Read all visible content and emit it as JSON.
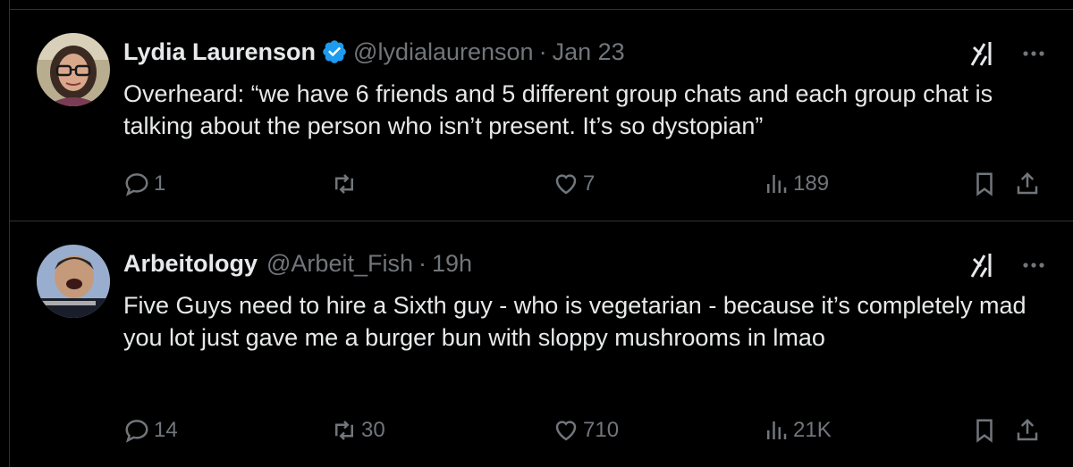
{
  "tweets": [
    {
      "name": "Lydia Laurenson",
      "verified": true,
      "handle": "@lydialaurenson",
      "separator": "·",
      "time": "Jan 23",
      "text": "Overheard: “we have 6 friends and 5 different group chats and each group chat is talking about the person who isn’t present. It’s so dystopian”",
      "replies": "1",
      "retweets": "",
      "likes": "7",
      "views": "189"
    },
    {
      "name": "Arbeitology",
      "verified": false,
      "handle": "@Arbeit_Fish",
      "separator": "·",
      "time": "19h",
      "text": "Five Guys need to hire a Sixth guy - who is vegetarian - because it’s completely mad you lot just gave me a burger bun with sloppy mushrooms in lmao",
      "replies": "14",
      "retweets": "30",
      "likes": "710",
      "views": "21K"
    }
  ],
  "icons": {
    "verified": "verified-badge-icon",
    "grok": "grok-icon",
    "more": "more-icon",
    "reply": "reply-icon",
    "retweet": "retweet-icon",
    "like": "like-icon",
    "views": "views-icon",
    "bookmark": "bookmark-icon",
    "share": "share-icon"
  },
  "colors": {
    "background": "#000000",
    "text": "#e7e9ea",
    "secondary": "#71767b",
    "verified": "#1d9bf0",
    "divider": "#2f3336"
  }
}
